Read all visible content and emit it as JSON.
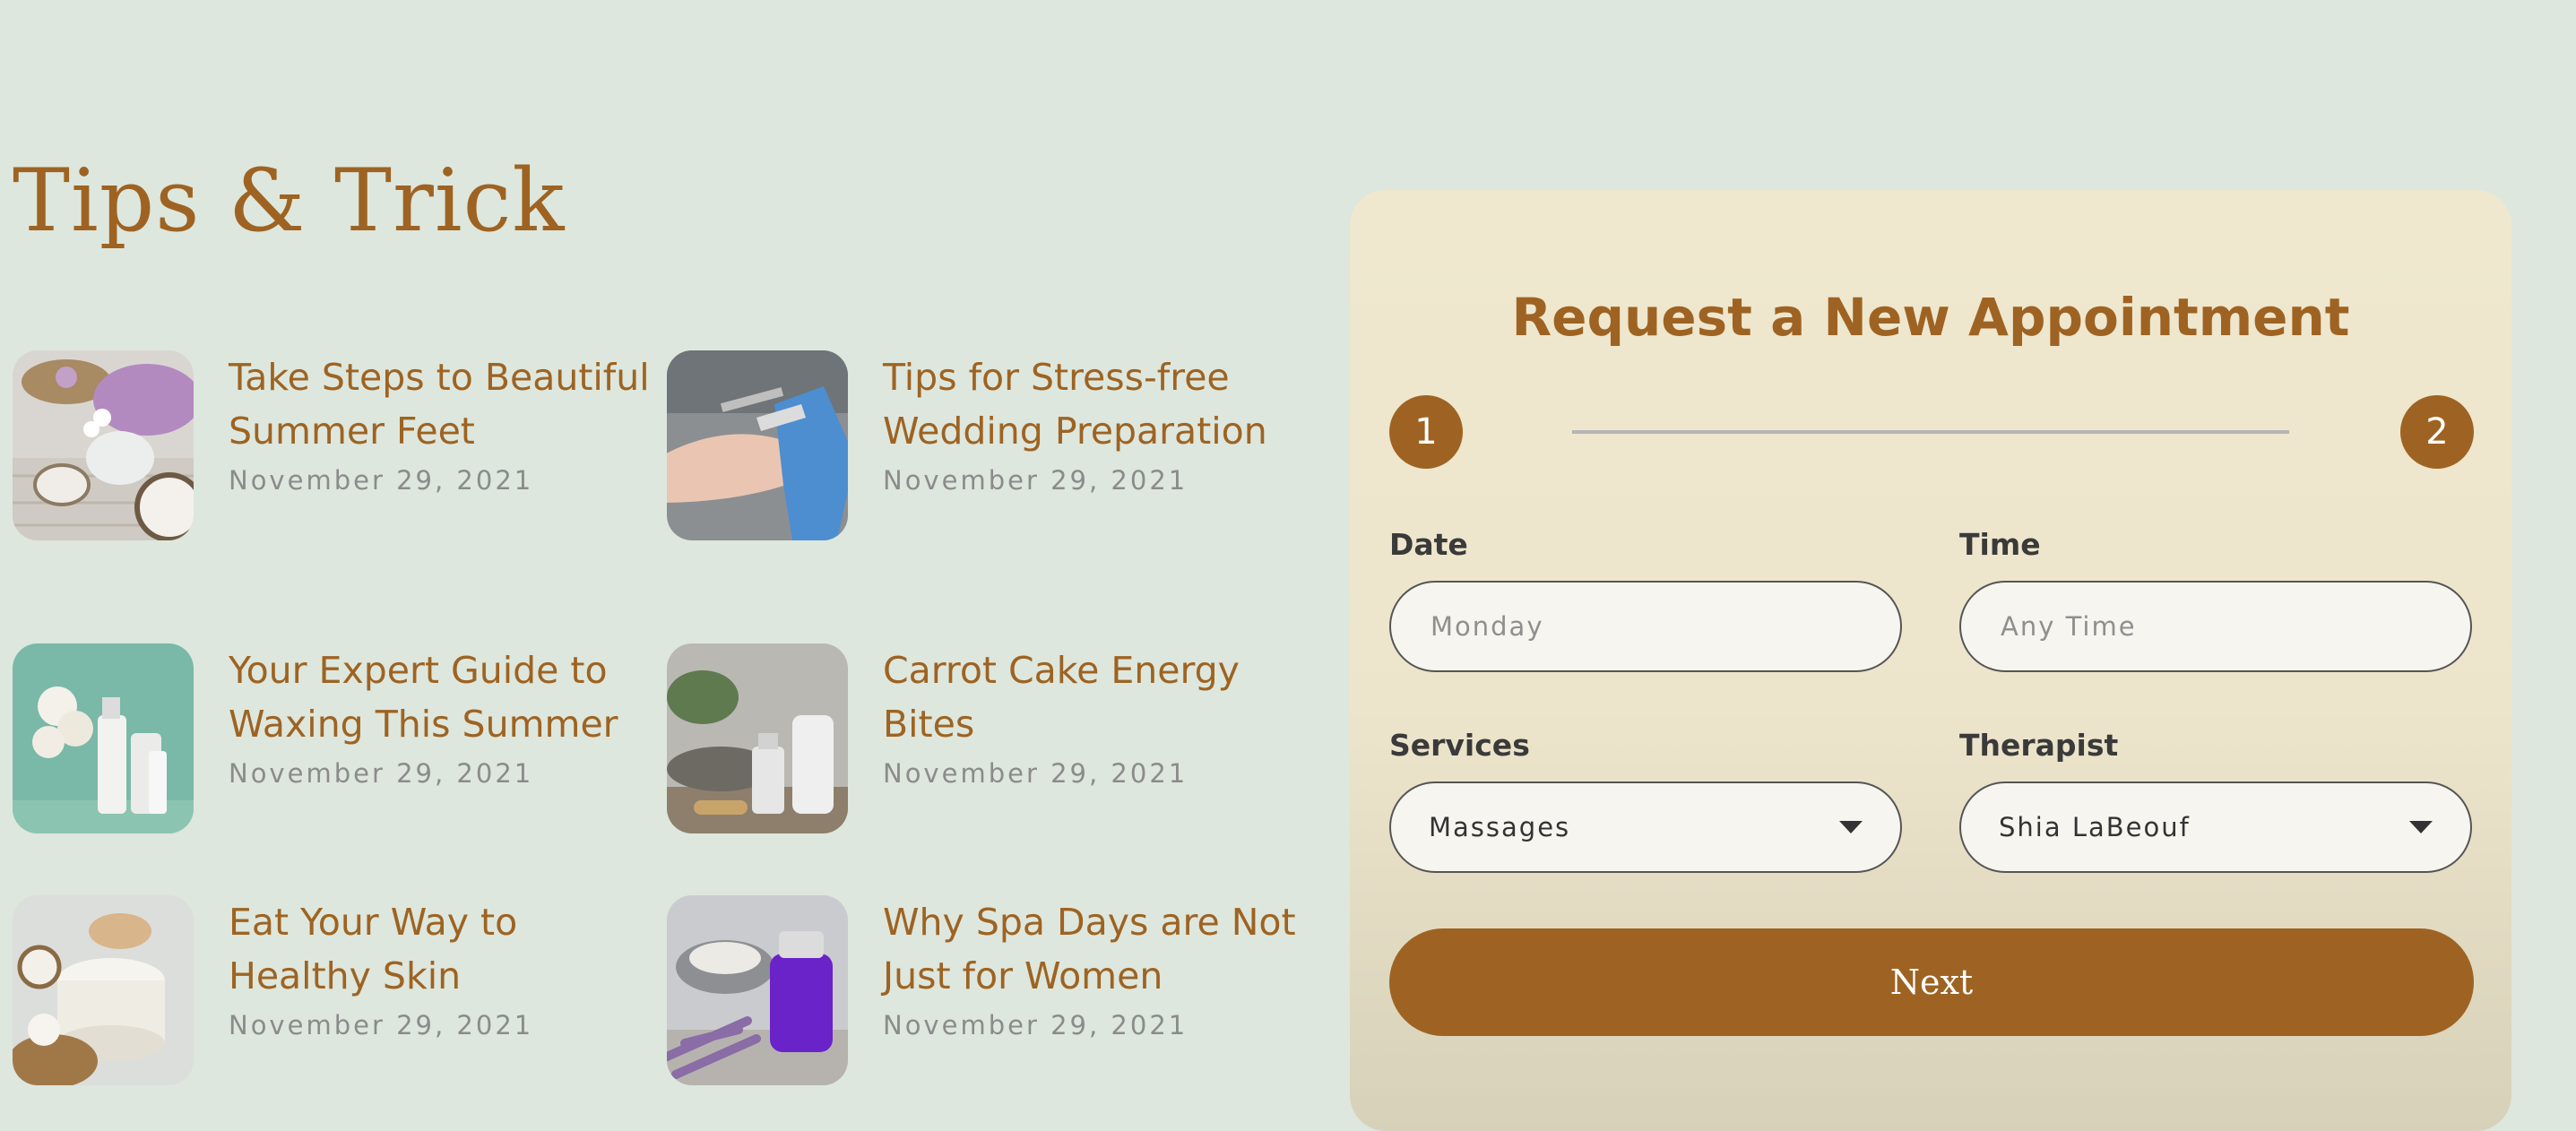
{
  "tips": {
    "title": "Tips & Trick",
    "posts": [
      {
        "title": "Take Steps to Beautiful Summer Feet",
        "date": "November 29, 2021"
      },
      {
        "title": "Tips for Stress-free Wedding Preparation",
        "date": "November 29, 2021"
      },
      {
        "title": "Your Expert Guide to Waxing This Summer",
        "date": "November 29, 2021"
      },
      {
        "title": "Carrot Cake Energy Bites",
        "date": "November 29, 2021"
      },
      {
        "title": "Eat Your Way to Healthy Skin",
        "date": "November 29, 2021"
      },
      {
        "title": "Why Spa Days are Not Just for Women",
        "date": "November 29, 2021"
      }
    ]
  },
  "appointment": {
    "title": "Request a New Appointment",
    "steps": [
      "1",
      "2"
    ],
    "date": {
      "label": "Date",
      "placeholder": "Monday"
    },
    "time": {
      "label": "Time",
      "placeholder": "Any Time"
    },
    "services": {
      "label": "Services",
      "value": "Massages"
    },
    "therapist": {
      "label": "Therapist",
      "value": "Shia LaBeouf"
    },
    "next_label": "Next"
  },
  "colors": {
    "accent": "#9e6322",
    "background": "#dde7dd",
    "card": "#efe8cf"
  }
}
